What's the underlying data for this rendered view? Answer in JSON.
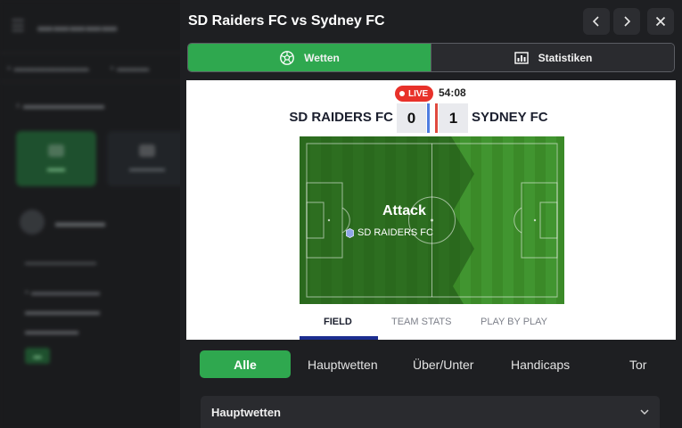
{
  "modal": {
    "title": "SD Raiders FC vs Sydney FC",
    "tabs": [
      {
        "label": "Wetten",
        "icon": "soccer-ball-icon",
        "active": true
      },
      {
        "label": "Statistiken",
        "icon": "stats-board-icon",
        "active": false
      }
    ]
  },
  "live_widget": {
    "live_label": "LIVE",
    "match_time": "54:08",
    "home_team": "SD RAIDERS FC",
    "away_team": "SYDNEY FC",
    "home_score": "0",
    "away_score": "1",
    "home_color": "#4f7de0",
    "away_color": "#e04a3f",
    "situation": "Attack",
    "situation_team": "SD RAIDERS FC",
    "tabs": [
      {
        "label": "FIELD",
        "active": true
      },
      {
        "label": "TEAM STATS",
        "active": false
      },
      {
        "label": "PLAY BY PLAY",
        "active": false
      }
    ]
  },
  "market_filters": [
    {
      "label": "Alle",
      "active": true
    },
    {
      "label": "Hauptwetten",
      "active": false
    },
    {
      "label": "Über/Unter",
      "active": false
    },
    {
      "label": "Handicaps",
      "active": false
    },
    {
      "label": "Tor",
      "active": false
    }
  ],
  "accordion": {
    "title": "Hauptwetten",
    "expanded": false
  },
  "colors": {
    "accent": "#2fa84f",
    "live": "#e8312a",
    "pitch": "#3b8c27"
  }
}
